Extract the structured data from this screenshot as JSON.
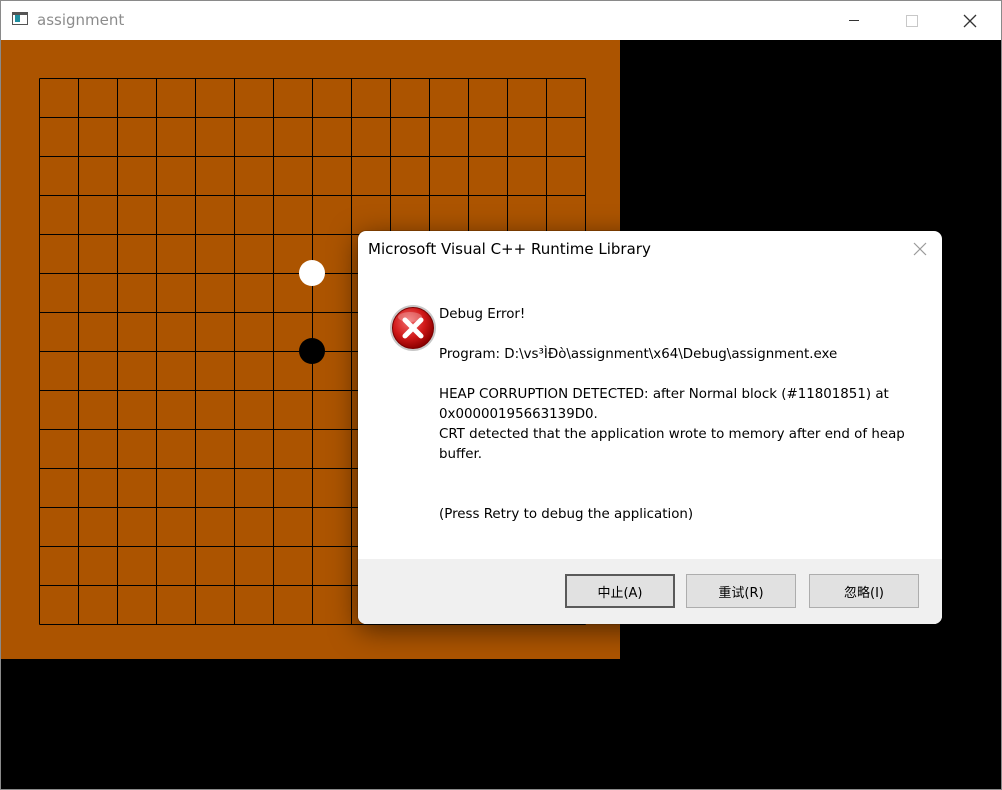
{
  "window": {
    "title": "assignment",
    "icon": "app-window-icon"
  },
  "board": {
    "color": "#ac5400",
    "grid_lines": 15,
    "stones": [
      {
        "color": "white",
        "col": 7,
        "row": 5
      },
      {
        "color": "black",
        "col": 7,
        "row": 7
      }
    ]
  },
  "dialog": {
    "title": "Microsoft Visual C++ Runtime Library",
    "icon": "error-icon",
    "heading": "Debug Error!",
    "program": "Program: D:\\vs³ÌÐò\\assignment\\x64\\Debug\\assignment.exe",
    "details": "HEAP CORRUPTION DETECTED: after Normal block (#11801851) at\n0x00000195663139D0.\nCRT detected that the application wrote to memory after end of heap\nbuffer.",
    "hint": "(Press Retry to debug the application)",
    "buttons": {
      "abort": "中止(A)",
      "retry": "重试(R)",
      "ignore": "忽略(I)"
    }
  }
}
